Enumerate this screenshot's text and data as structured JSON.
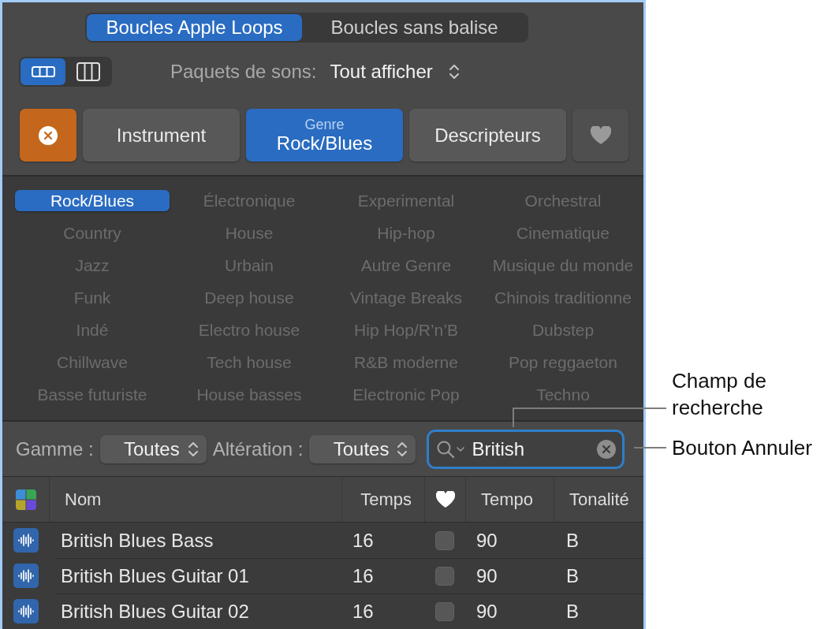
{
  "browser_tabs": [
    {
      "label": "Boucles Apple Loops",
      "selected": true
    },
    {
      "label": "Boucles sans balise",
      "selected": false
    }
  ],
  "view_toggle": [
    {
      "selected": true
    },
    {
      "selected": false
    }
  ],
  "sound_packs": {
    "label": "Paquets de sons:",
    "value": "Tout afficher"
  },
  "filter_buttons": [
    {
      "kind": "reset",
      "active": true
    },
    {
      "kind": "category",
      "label": "Instrument",
      "selected": false
    },
    {
      "kind": "category",
      "caption": "Genre",
      "label": "Rock/Blues",
      "selected": true
    },
    {
      "kind": "category",
      "label": "Descripteurs",
      "selected": false
    },
    {
      "kind": "favorites",
      "selected": false
    }
  ],
  "genres": [
    {
      "label": "Rock/Blues",
      "selected": true
    },
    {
      "label": "Électronique",
      "selected": false
    },
    {
      "label": "Experimental",
      "selected": false
    },
    {
      "label": "Orchestral",
      "selected": false
    },
    {
      "label": "Country",
      "selected": false
    },
    {
      "label": "House",
      "selected": false
    },
    {
      "label": "Hip-hop",
      "selected": false
    },
    {
      "label": "Cinematique",
      "selected": false
    },
    {
      "label": "Jazz",
      "selected": false
    },
    {
      "label": "Urbain",
      "selected": false
    },
    {
      "label": "Autre Genre",
      "selected": false
    },
    {
      "label": "Musique du monde",
      "selected": false
    },
    {
      "label": "Funk",
      "selected": false
    },
    {
      "label": "Deep house",
      "selected": false
    },
    {
      "label": "Vintage Breaks",
      "selected": false
    },
    {
      "label": "Chinois traditionne",
      "selected": false
    },
    {
      "label": "Indé",
      "selected": false
    },
    {
      "label": "Electro house",
      "selected": false
    },
    {
      "label": "Hip Hop/R’n’B",
      "selected": false
    },
    {
      "label": "Dubstep",
      "selected": false
    },
    {
      "label": "Chillwave",
      "selected": false
    },
    {
      "label": "Tech house",
      "selected": false
    },
    {
      "label": "R&B moderne",
      "selected": false
    },
    {
      "label": "Pop reggaeton",
      "selected": false
    },
    {
      "label": "Basse futuriste",
      "selected": false
    },
    {
      "label": "House basses",
      "selected": false
    },
    {
      "label": "Electronic Pop",
      "selected": false
    },
    {
      "label": "Techno",
      "selected": false
    }
  ],
  "filters": [
    {
      "label": "Gamme :",
      "value": "Toutes"
    },
    {
      "label": "Altération :",
      "value": "Toutes"
    }
  ],
  "search": {
    "value": "British",
    "focused": true
  },
  "table": {
    "columns": [
      {
        "kind": "swatch"
      },
      {
        "kind": "text",
        "label": "Nom"
      },
      {
        "kind": "text",
        "label": "Temps"
      },
      {
        "kind": "heart"
      },
      {
        "kind": "text",
        "label": "Tempo"
      },
      {
        "kind": "text",
        "label": "Tonalité"
      }
    ],
    "rows": [
      {
        "name": "British Blues Bass",
        "beats": "16",
        "favorite": false,
        "tempo": "90",
        "key": "B"
      },
      {
        "name": "British Blues Guitar 01",
        "beats": "16",
        "favorite": false,
        "tempo": "90",
        "key": "B"
      },
      {
        "name": "British Blues Guitar 02",
        "beats": "16",
        "favorite": false,
        "tempo": "90",
        "key": "B"
      }
    ]
  },
  "callouts": [
    {
      "text": "Champ de recherche"
    },
    {
      "text": "Bouton Annuler"
    }
  ]
}
